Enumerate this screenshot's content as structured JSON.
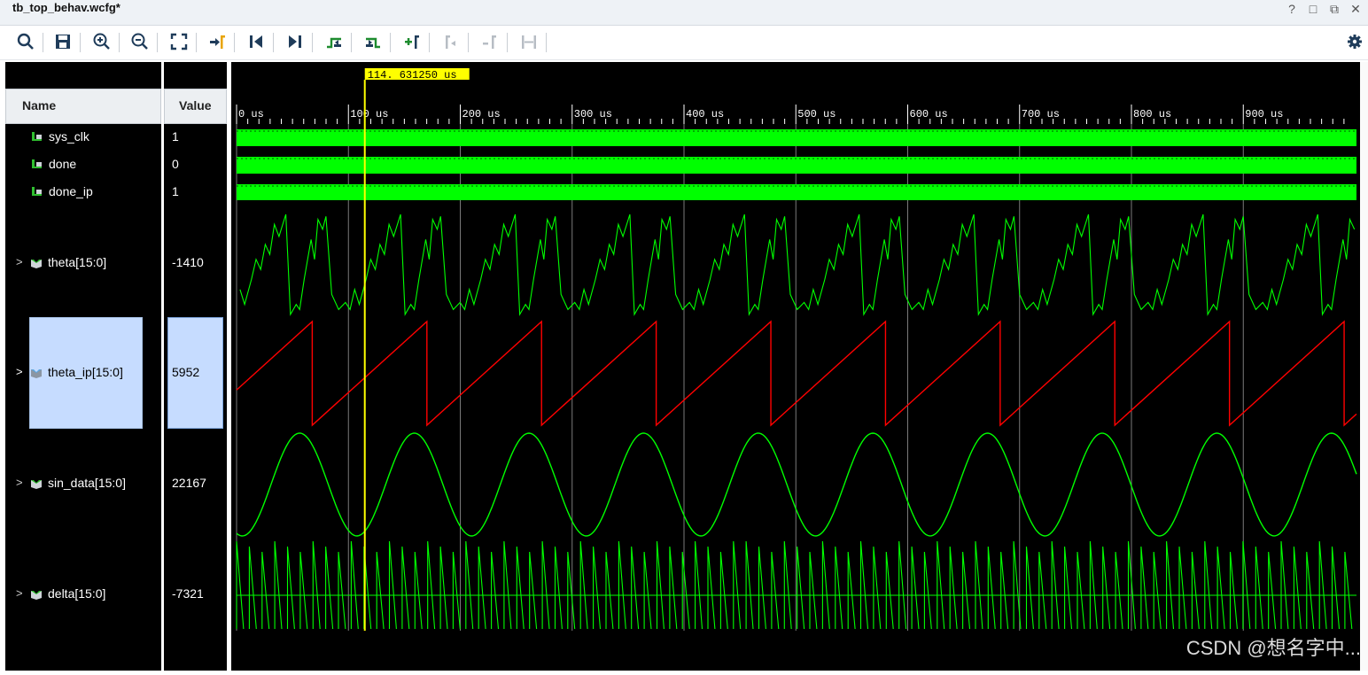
{
  "window": {
    "title": "tb_top_behav.wcfg*",
    "controls": [
      "?",
      "□",
      "⧉",
      "✕"
    ]
  },
  "toolbar": {
    "buttons": [
      {
        "name": "search-button",
        "icon": "search-icon"
      },
      {
        "name": "save-button",
        "icon": "save-icon"
      },
      {
        "name": "zoom-in-button",
        "icon": "zoom-in-icon"
      },
      {
        "name": "zoom-out-button",
        "icon": "zoom-out-icon"
      },
      {
        "name": "zoom-fit-button",
        "icon": "zoom-fit-icon"
      },
      {
        "name": "go-to-cursor-button",
        "icon": "go-to-cursor-icon"
      },
      {
        "name": "go-to-time-zero-button",
        "icon": "go-to-start-icon"
      },
      {
        "name": "go-to-last-time-button",
        "icon": "go-to-end-icon"
      },
      {
        "name": "previous-transition-button",
        "icon": "previous-transition-icon"
      },
      {
        "name": "next-transition-button",
        "icon": "next-transition-icon"
      },
      {
        "name": "add-marker-button",
        "icon": "add-marker-icon"
      },
      {
        "name": "previous-marker-button",
        "icon": "previous-marker-icon"
      },
      {
        "name": "next-marker-button",
        "icon": "next-marker-icon"
      },
      {
        "name": "swap-cursors-button",
        "icon": "swap-cursors-icon"
      }
    ],
    "settings_icon": "gear-icon"
  },
  "columns": {
    "name_header": "Name",
    "value_header": "Value"
  },
  "signals": [
    {
      "name": "sys_clk",
      "value": "1",
      "type": "bit",
      "expandable": false
    },
    {
      "name": "done",
      "value": "0",
      "type": "bit",
      "expandable": false
    },
    {
      "name": "done_ip",
      "value": "1",
      "type": "bit",
      "expandable": false
    },
    {
      "name": "theta[15:0]",
      "value": "-1410",
      "type": "bus",
      "expandable": true
    },
    {
      "name": "theta_ip[15:0]",
      "value": "5952",
      "type": "bus",
      "expandable": true,
      "selected": true
    },
    {
      "name": "sin_data[15:0]",
      "value": "22167",
      "type": "bus",
      "expandable": true
    },
    {
      "name": "delta[15:0]",
      "value": "-7321",
      "type": "bus",
      "expandable": true
    }
  ],
  "timeline": {
    "cursor_label": "114. 631250 us",
    "cursor_time_us": 114.63125,
    "ticks": [
      "0 us",
      "100 us",
      "200 us",
      "300 us",
      "400 us",
      "500 us",
      "600 us",
      "700 us",
      "800 us",
      "900 us"
    ],
    "tick_values_us": [
      0,
      100,
      200,
      300,
      400,
      500,
      600,
      700,
      800,
      900
    ],
    "range_us": [
      0,
      1000
    ],
    "period_us": 102.5
  },
  "colors": {
    "wave_green": "#00ff00",
    "wave_red": "#ff0000",
    "cursor_yellow": "#ffff00",
    "selection": "#c6dcff"
  },
  "watermark": "CSDN @想名字中..."
}
